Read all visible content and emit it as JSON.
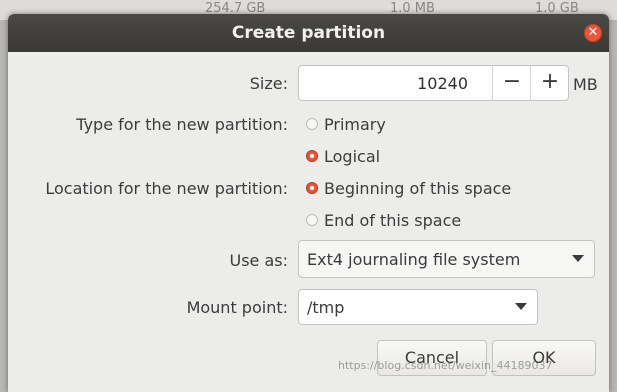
{
  "background_row": {
    "col1": "254.7 GB",
    "col2": "1.0 MB",
    "col3": "1.0 GB"
  },
  "dialog": {
    "title": "Create partition",
    "close_icon": "close-icon"
  },
  "size": {
    "label": "Size:",
    "value": "10240",
    "minus": "−",
    "plus": "+",
    "unit": "MB"
  },
  "type": {
    "label": "Type for the new partition:",
    "options": [
      {
        "label": "Primary",
        "checked": false
      },
      {
        "label": "Logical",
        "checked": true
      }
    ]
  },
  "location": {
    "label": "Location for the new partition:",
    "options": [
      {
        "label": "Beginning of this space",
        "checked": true
      },
      {
        "label": "End of this space",
        "checked": false
      }
    ]
  },
  "use_as": {
    "label": "Use as:",
    "value": "Ext4 journaling file system"
  },
  "mount_point": {
    "label": "Mount point:",
    "value": "/tmp"
  },
  "buttons": {
    "cancel": "Cancel",
    "ok": "OK"
  },
  "watermark": "https://blog.csdn.net/weixin_44189037",
  "colors": {
    "accent": "#e9553b",
    "titlebar": "#3d3c39",
    "dialog_bg": "#ececea"
  }
}
